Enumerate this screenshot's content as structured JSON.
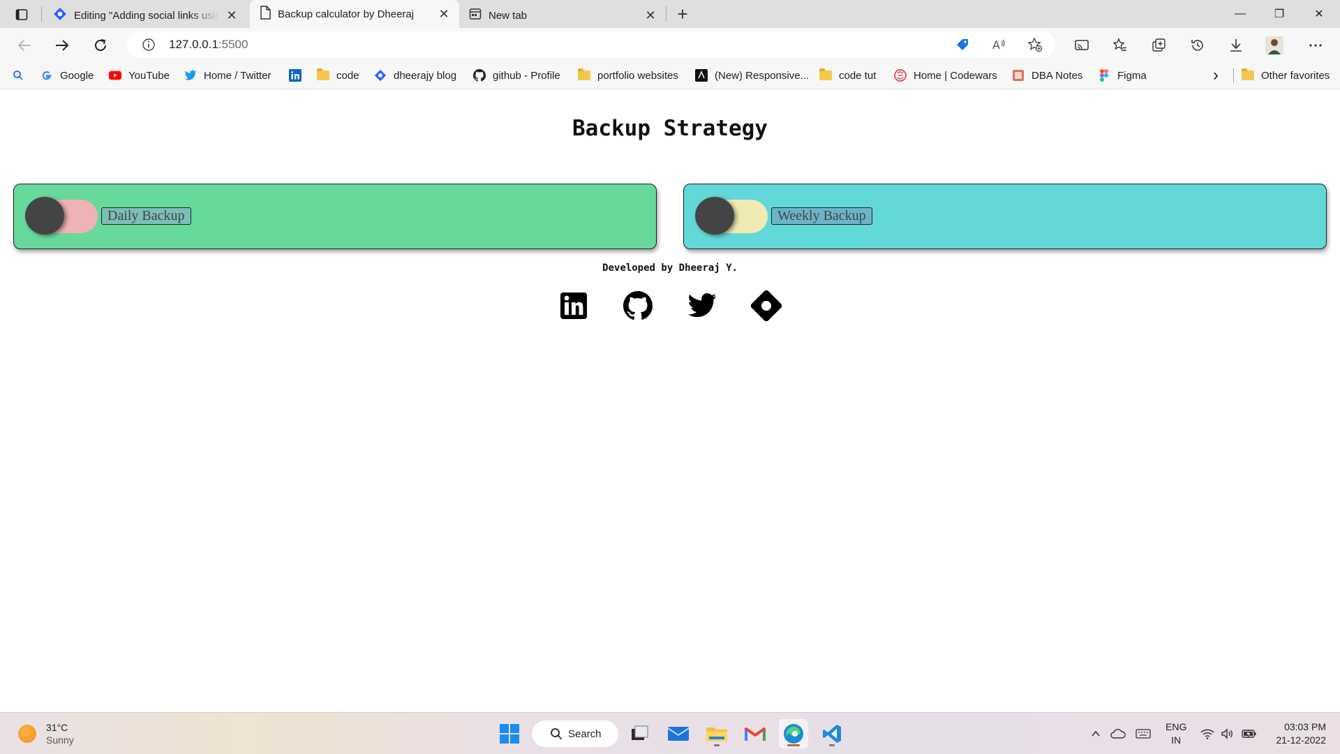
{
  "browser": {
    "tabs": [
      {
        "title": "Editing \"Adding social links using",
        "close": "✕"
      },
      {
        "title": "Backup calculator by Dheeraj",
        "close": "✕"
      },
      {
        "title": "New tab",
        "close": "✕"
      }
    ],
    "new_tab": "+",
    "window_controls": {
      "minimize": "—",
      "restore": "❐",
      "close": "✕"
    },
    "address": {
      "host": "127.0.0.1",
      "port": ":5500"
    },
    "favorites": [
      {
        "label": "Google",
        "icon": "google-icon"
      },
      {
        "label": "YouTube",
        "icon": "youtube-icon"
      },
      {
        "label": "Home / Twitter",
        "icon": "twitter-icon"
      },
      {
        "label": "",
        "icon": "linkedin-icon"
      },
      {
        "label": "code",
        "icon": "folder-icon"
      },
      {
        "label": "dheerajy blog",
        "icon": "hashnode-icon"
      },
      {
        "label": "github - Profile",
        "icon": "github-icon"
      },
      {
        "label": "portfolio websites",
        "icon": "folder-icon"
      },
      {
        "label": "(New) Responsive...",
        "icon": "codepen-icon"
      },
      {
        "label": "code tut",
        "icon": "folder-icon"
      },
      {
        "label": "Home | Codewars",
        "icon": "codewars-icon"
      },
      {
        "label": "DBA Notes",
        "icon": "notes-icon"
      },
      {
        "label": "Figma",
        "icon": "figma-icon"
      }
    ],
    "more_favorites": "›",
    "other_favorites": "Other favorites"
  },
  "page": {
    "title": "Backup Strategy",
    "cards": [
      {
        "label": "Daily Backup",
        "toggle_color": "#efb3b5",
        "toggle_on": false
      },
      {
        "label": "Weekly Backup",
        "toggle_color": "#f0ebb4",
        "toggle_on": false
      }
    ],
    "credit": "Developed by Dheeraj Y.",
    "socials": [
      "linkedin-icon",
      "github-icon",
      "twitter-icon",
      "hashnode-icon"
    ]
  },
  "taskbar": {
    "weather": {
      "temp": "31°C",
      "condition": "Sunny"
    },
    "search_label": "Search",
    "lang": {
      "line1": "ENG",
      "line2": "IN"
    },
    "clock": {
      "time": "03:03 PM",
      "date": "21-12-2022"
    }
  },
  "colors": {
    "daily_card": "#66d99b",
    "weekly_card": "#62d8d8",
    "knob": "#444444"
  }
}
